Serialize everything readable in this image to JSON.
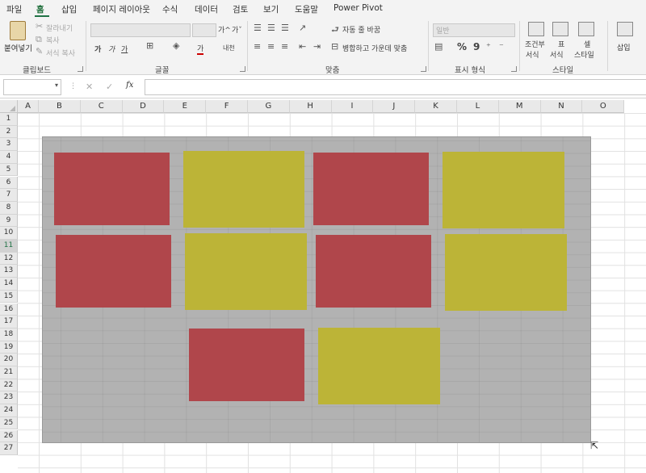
{
  "menu": {
    "tabs": [
      "파일",
      "홈",
      "삽입",
      "페이지 레이아웃",
      "수식",
      "데이터",
      "검토",
      "보기",
      "도움말",
      "Power Pivot"
    ],
    "active_tab": "홈"
  },
  "ribbon": {
    "clipboard": {
      "paste_label": "붙여넣기",
      "cut_label": "잘라내기",
      "copy_label": "복사",
      "format_painter_label": "서식 복사",
      "group_label": "클립보드"
    },
    "font": {
      "grow_label": "가^",
      "shrink_label": "가ˇ",
      "bold": "가",
      "italic": "가",
      "underline": "가",
      "font_color_glyph": "가",
      "phonetic": "내천",
      "group_label": "글꼴"
    },
    "alignment": {
      "wrap_label": "자동 줄 바꿈",
      "merge_label": "병합하고 가운데 맞춤",
      "group_label": "맞춤"
    },
    "number": {
      "format_value": "일반",
      "percent": "%",
      "comma": "9",
      "group_label": "표시 형식"
    },
    "styles": {
      "conditional_label_1": "조건부",
      "conditional_label_2": "서식",
      "table_label_1": "표",
      "table_label_2": "서식",
      "cell_label_1": "셀",
      "cell_label_2": "스타일",
      "group_label": "스타일"
    },
    "cells": {
      "insert_label": "삽입"
    }
  },
  "formula_bar": {
    "name_box": "",
    "cancel": "✕",
    "enter": "✓",
    "fx": "fx",
    "formula": ""
  },
  "columns": [
    "A",
    "B",
    "C",
    "D",
    "E",
    "F",
    "G",
    "H",
    "I",
    "J",
    "K",
    "L",
    "M",
    "N",
    "O"
  ],
  "rows": [
    "1",
    "2",
    "3",
    "4",
    "5",
    "6",
    "7",
    "8",
    "9",
    "10",
    "11",
    "12",
    "13",
    "14",
    "15",
    "16",
    "17",
    "18",
    "19",
    "20",
    "21",
    "22",
    "23",
    "24",
    "25",
    "26",
    "27"
  ],
  "selected_row": "11",
  "colors": {
    "canvas": "#b2b2b2",
    "red_shape": "#b0464b",
    "yellow_shape": "#bcb437",
    "accent": "#217346"
  }
}
